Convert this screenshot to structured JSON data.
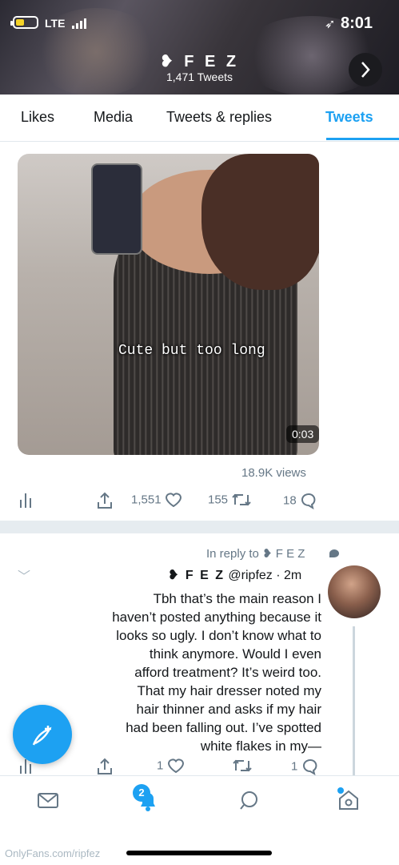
{
  "status_bar": {
    "time": "8:01",
    "network": "LTE",
    "location_icon": "location-arrow-icon"
  },
  "profile": {
    "name": "❥ F E Z",
    "tweet_count": "1,471 Tweets"
  },
  "tabs": [
    {
      "label": "Tweets",
      "active": true
    },
    {
      "label": "Tweets & replies",
      "active": false
    },
    {
      "label": "Media",
      "active": false
    },
    {
      "label": "Likes",
      "active": false
    }
  ],
  "media_tweet": {
    "video_caption": "Cute but too long",
    "duration": "0:03",
    "views": "18.9K views",
    "replies": "18",
    "retweets": "155",
    "likes": "1,551"
  },
  "reply_tweet": {
    "in_reply_to": "In reply to ❥ F E Z",
    "author_name": "❥ F E Z",
    "author_meta": "@ripfez · 2m",
    "text": "Tbh that’s the main reason I haven’t posted anything because it looks so ugly. I don’t know what to think anymore. Would I even afford treatment? It’s weird too. That my hair dresser noted my hair thinner and asks if my hair had been falling out. I’ve spotted white flakes in my—",
    "replies": "1",
    "retweets": "",
    "likes": "1"
  },
  "bottom_nav": {
    "notifications_badge": "2"
  },
  "watermark": "OnlyFans.com/ripfez",
  "colors": {
    "accent": "#1da1f2",
    "muted": "#657786",
    "border": "#e1e8ed"
  }
}
